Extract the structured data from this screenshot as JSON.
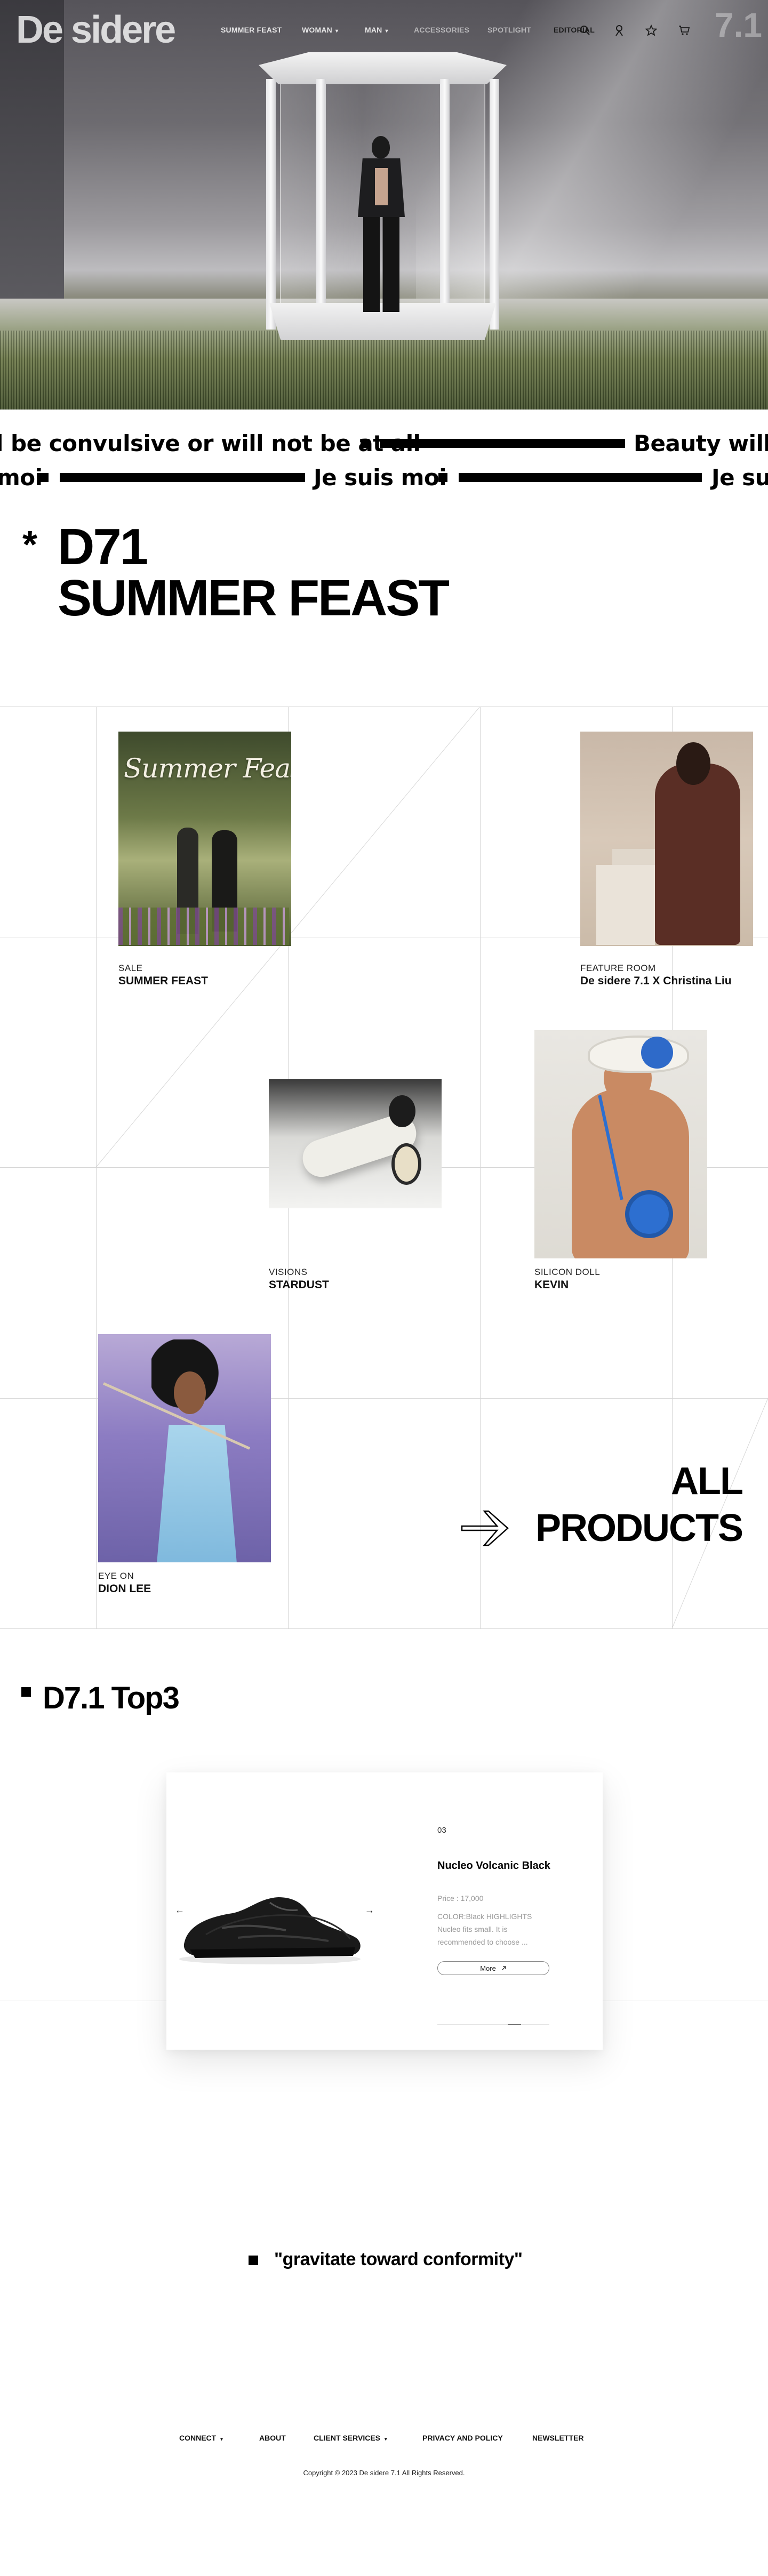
{
  "header": {
    "logo": "De sidere",
    "badge": "7.1",
    "nav": [
      {
        "label": "SUMMER FEAST",
        "caret": ""
      },
      {
        "label": "WOMAN",
        "caret": "▾"
      },
      {
        "label": "MAN",
        "caret": "▾"
      },
      {
        "label": "ACCESSORIES",
        "caret": ""
      },
      {
        "label": "SPOTLIGHT",
        "caret": ""
      },
      {
        "label": "EDITORIAL",
        "caret": ""
      }
    ],
    "icons": [
      "search-icon",
      "user-icon",
      "star-icon",
      "cart-icon"
    ]
  },
  "marquee": {
    "row1": {
      "text_a": "l be convulsive or will not be at all",
      "text_b": "Beauty will b"
    },
    "row2": {
      "text_a": "moi",
      "text_b": "Je suis moi",
      "text_c": "Je su"
    }
  },
  "section": {
    "asterisk": "*",
    "title_line1": "D71",
    "title_line2": "SUMMER FEAST"
  },
  "cards": [
    {
      "kicker": "SALE",
      "title": "SUMMER FEAST",
      "image_text": "Summer Feast"
    },
    {
      "kicker": "FEATURE ROOM",
      "title": "De sidere 7.1 X Christina Liu"
    },
    {
      "kicker": "VISIONS",
      "title": "STARDUST"
    },
    {
      "kicker": "SILICON DOLL",
      "title": "KEVIN"
    },
    {
      "kicker": "EYE ON",
      "title": "DION LEE"
    }
  ],
  "all_products": {
    "line1": "ALL",
    "line2": "PRODUCTS"
  },
  "top3": {
    "title": "D7.1 Top3",
    "product": {
      "index": "03",
      "name": "Nucleo Volcanic Black",
      "price": "Price : 17,000",
      "description": "COLOR:Black HIGHLIGHTS Nucleo fits small. It is recommended to choose ...",
      "more_label": "More",
      "progress": 0.75,
      "prev_label": "←",
      "next_label": "→"
    }
  },
  "quote": "\"gravitate toward conformity\"",
  "footer": {
    "links": [
      {
        "label": "CONNECT",
        "caret": "▾"
      },
      {
        "label": "ABOUT",
        "caret": ""
      },
      {
        "label": "CLIENT SERVICES",
        "caret": "▾"
      },
      {
        "label": "PRIVACY AND POLICY",
        "caret": ""
      },
      {
        "label": "NEWSLETTER",
        "caret": ""
      }
    ],
    "copyright": "Copyright © 2023 De sidere 7.1 All Rights Reserved."
  },
  "colors": {
    "text": "#000000",
    "background": "#ffffff",
    "grid": "#d6d6d6"
  }
}
